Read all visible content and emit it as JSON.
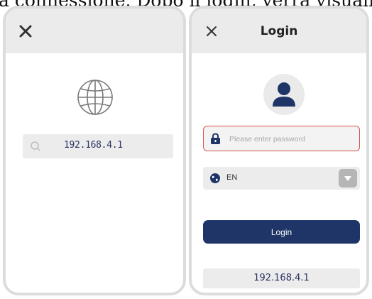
{
  "caption": "la connessione. Dopo il login, verrà visualiz",
  "browser_screen": {
    "address": "192.168.4.1"
  },
  "login_screen": {
    "title": "Login",
    "password_placeholder": "Please enter password",
    "language": "EN",
    "login_button": "Login",
    "ip_address": "192.168.4.1"
  },
  "icons": [
    "close-icon",
    "globe-icon",
    "search-icon",
    "user-icon",
    "lock-icon",
    "chevron-down-icon"
  ],
  "colors": {
    "primary": "#1f3567",
    "error_border": "#d9534f",
    "topbar_bg": "#ebebeb",
    "field_bg": "#ececec"
  }
}
